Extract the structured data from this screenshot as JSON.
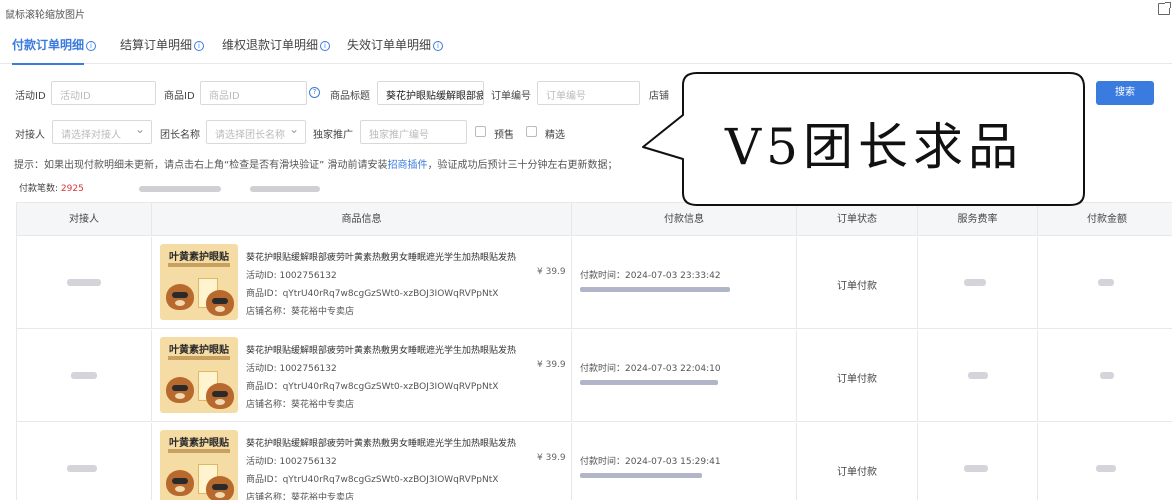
{
  "topbar": {
    "hint": "鼠标滚轮缩放图片"
  },
  "tabs": [
    {
      "label": "付款订单明细",
      "active": true
    },
    {
      "label": "结算订单明细",
      "active": false
    },
    {
      "label": "维权退款订单明细",
      "active": false
    },
    {
      "label": "失效订单单明细",
      "active": false
    }
  ],
  "filters": {
    "activity_id": {
      "label": "活动ID",
      "placeholder": "活动ID"
    },
    "product_id": {
      "label": "商品ID",
      "placeholder": "商品ID"
    },
    "product_title": {
      "label": "商品标题",
      "value": "葵花护眼贴缓解眼部疲劳"
    },
    "order_no": {
      "label": "订单编号",
      "placeholder": "订单编号"
    },
    "shop": {
      "label": "店铺"
    },
    "contact": {
      "label": "对接人",
      "placeholder": "请选择对接人"
    },
    "leader": {
      "label": "团长名称",
      "placeholder": "请选择团长名称"
    },
    "exclusive": {
      "label": "独家推广",
      "placeholder": "独家推广编号"
    },
    "presale": {
      "label": "预售"
    },
    "selected": {
      "label": "精选"
    },
    "search_button": "搜索"
  },
  "tip": {
    "prefix": "提示：如果出现付款明细未更新，请点击右上角",
    "quote": "“检查是否有滑块验证”",
    "mid": " 滑动前请安装",
    "link": "招商插件",
    "suffix": "，验证成功后预计三十分钟左右更新数据；"
  },
  "count": {
    "label": "付款笔数:",
    "value": "2925"
  },
  "table": {
    "headers": [
      "对接人",
      "商品信息",
      "付款信息",
      "订单状态",
      "服务费率",
      "付款金额"
    ],
    "rows": [
      {
        "thumb_title": "叶黄素护眼贴",
        "product_title": "葵花护眼贴缓解眼部疲劳叶黄素热敷男女睡眠遮光学生加热眼贴发热",
        "activity_id": "活动ID: 1002756132",
        "product_id": "商品ID：qYtrU40rRq7w8cgGzSWt0-xzBOJ3IOWqRVPpNtX",
        "shop": "店铺名称：葵花裕中专卖店",
        "price": "¥ 39.9",
        "pay_time": "付款时间：2024-07-03 23:33:42",
        "status": "订单付款"
      },
      {
        "thumb_title": "叶黄素护眼贴",
        "product_title": "葵花护眼贴缓解眼部疲劳叶黄素热敷男女睡眠遮光学生加热眼贴发热",
        "activity_id": "活动ID: 1002756132",
        "product_id": "商品ID：qYtrU40rRq7w8cgGzSWt0-xzBOJ3IOWqRVPpNtX",
        "shop": "店铺名称：葵花裕中专卖店",
        "price": "¥ 39.9",
        "pay_time": "付款时间：2024-07-03 22:04:10",
        "status": "订单付款"
      },
      {
        "thumb_title": "叶黄素护眼贴",
        "product_title": "葵花护眼贴缓解眼部疲劳叶黄素热敷男女睡眠遮光学生加热眼贴发热",
        "activity_id": "活动ID: 1002756132",
        "product_id": "商品ID：qYtrU40rRq7w8cgGzSWt0-xzBOJ3IOWqRVPpNtX",
        "shop": "店铺名称：葵花裕中专卖店",
        "price": "¥ 39.9",
        "pay_time": "付款时间：2024-07-03 15:29:41",
        "status": "订单付款"
      }
    ]
  },
  "callout": {
    "text": "V5团长求品"
  },
  "colors": {
    "accent": "#3a7be0",
    "count_red": "#d9363e"
  }
}
